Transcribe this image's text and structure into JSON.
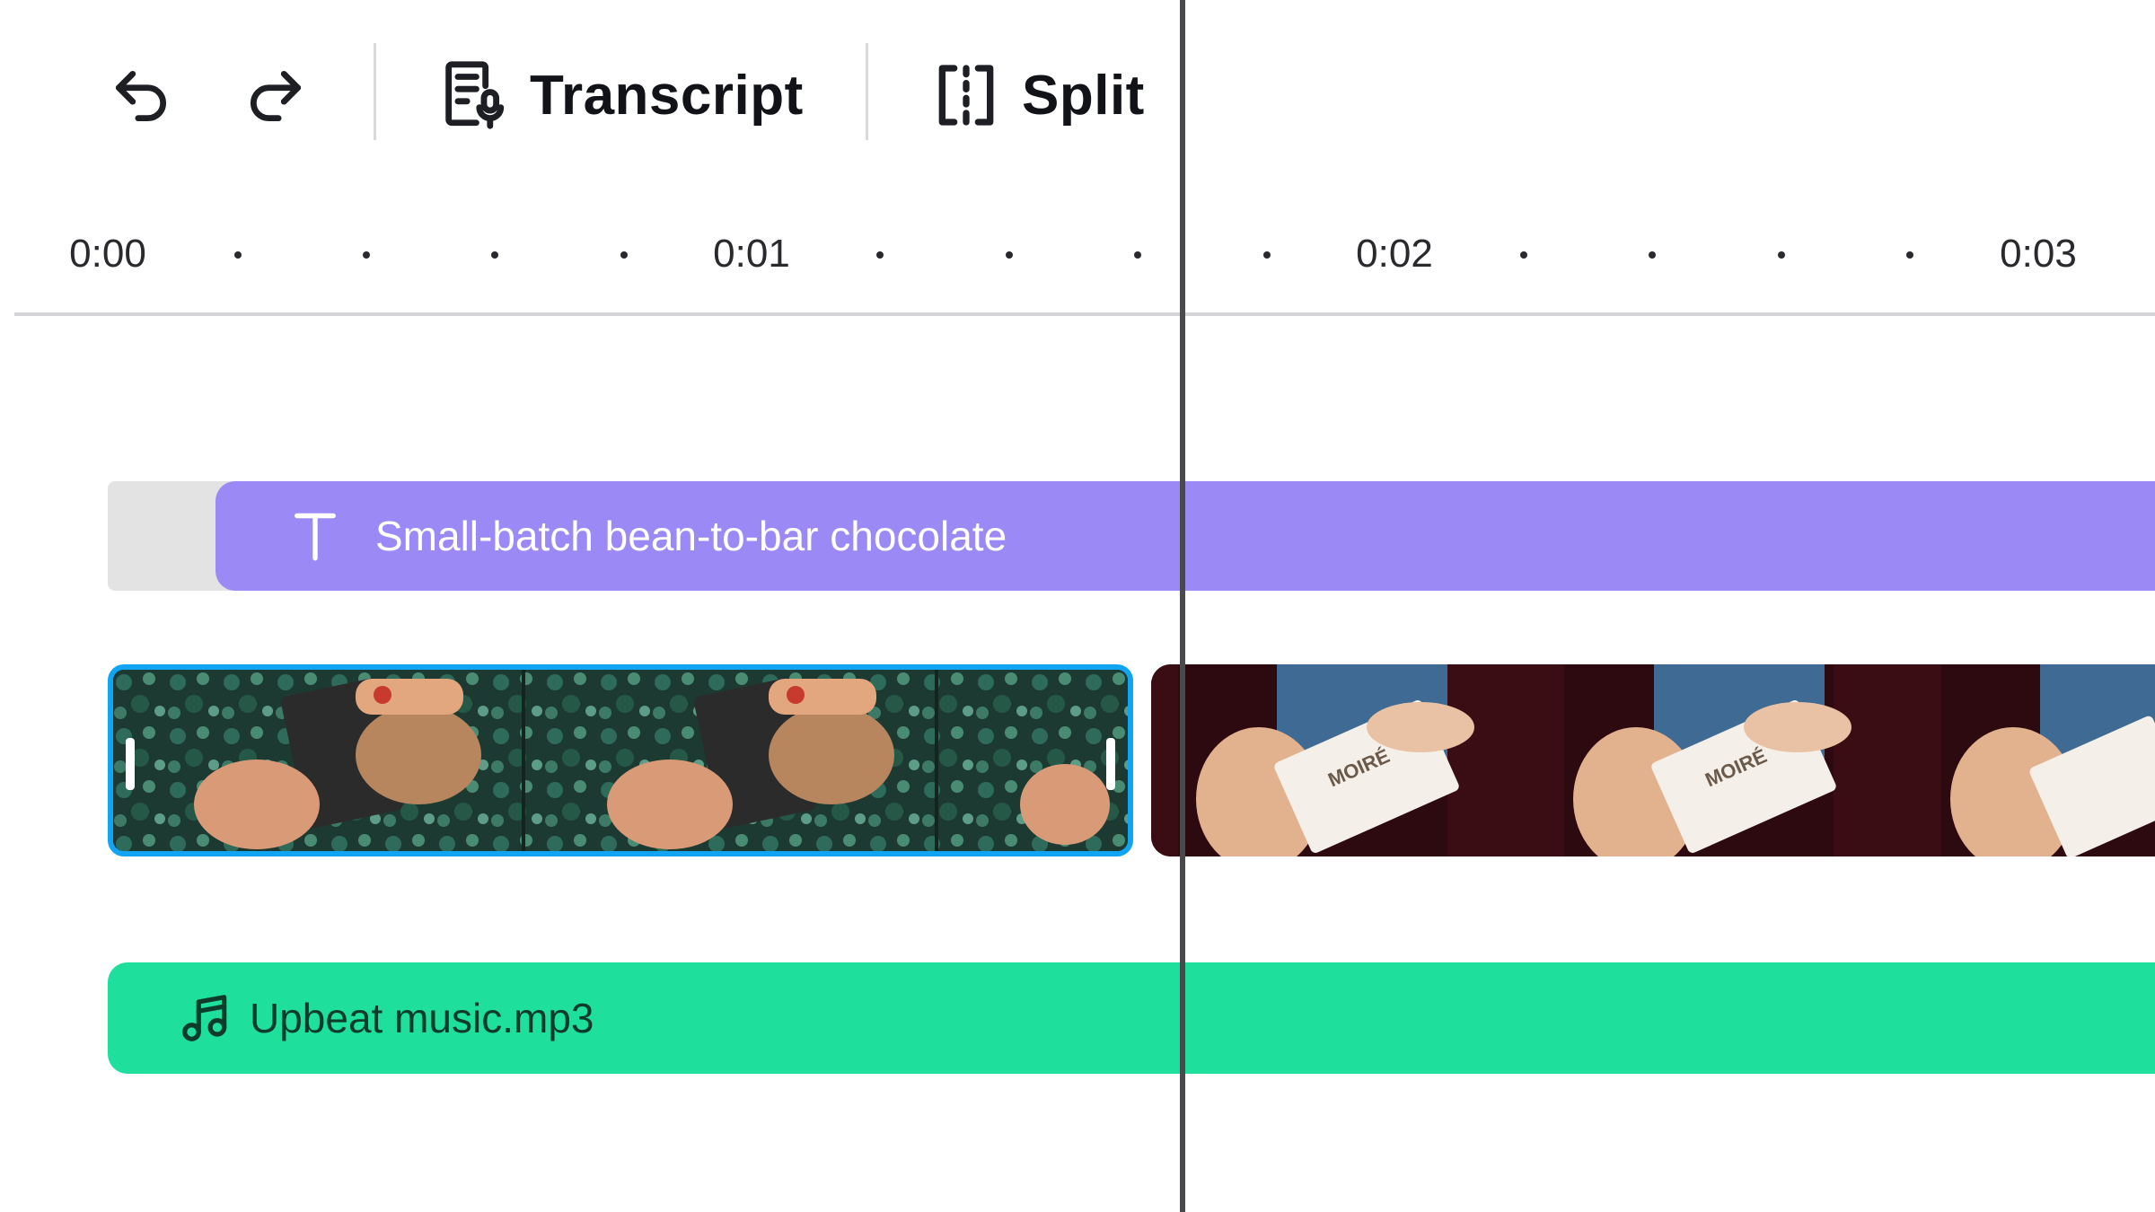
{
  "toolbar": {
    "undo_icon": "undo-icon",
    "redo_icon": "redo-icon",
    "transcript_label": "Transcript",
    "transcript_icon": "transcript-icon",
    "split_label": "Split",
    "split_icon": "split-icon"
  },
  "ruler": {
    "labels": [
      "0:00",
      "0:01",
      "0:02",
      "0:03"
    ]
  },
  "tracks": {
    "text_clip": {
      "label": "Small-batch bean-to-bar chocolate",
      "icon": "text-icon",
      "color": "#9b8af6"
    },
    "video_clips": [
      {
        "name": "video-clip-1",
        "selected": true,
        "accent": "#11a4f2"
      },
      {
        "name": "video-clip-2",
        "selected": false,
        "package_text": "MOIRÉ"
      }
    ],
    "audio_clip": {
      "label": "Upbeat music.mp3",
      "icon": "music-note-icon",
      "color": "#1fdf9d"
    }
  }
}
